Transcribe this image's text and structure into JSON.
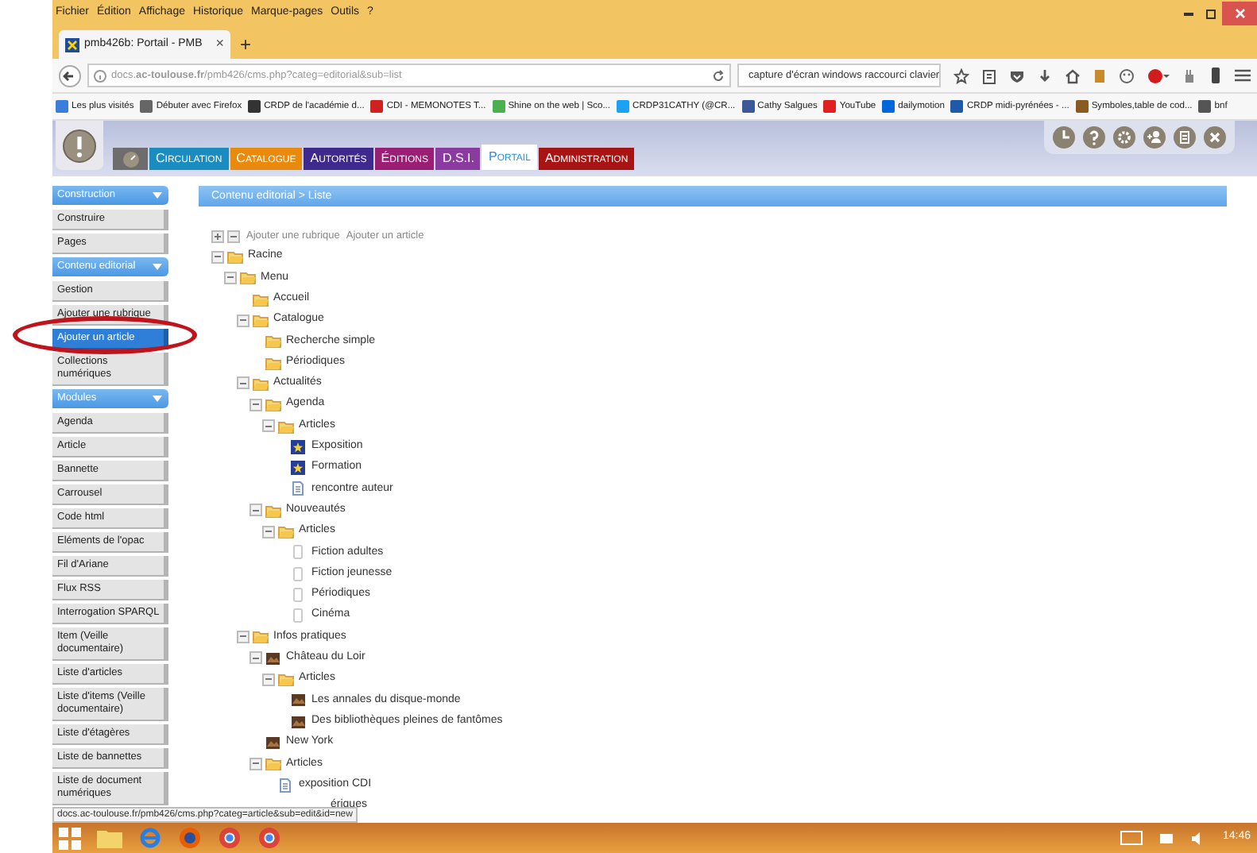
{
  "browser": {
    "menu": [
      "Fichier",
      "Édition",
      "Affichage",
      "Historique",
      "Marque-pages",
      "Outils",
      "?"
    ],
    "tab": {
      "title": "pmb426b: Portail - PMB",
      "close": "×"
    },
    "new_tab": "+",
    "url": "docs.**ac-toulouse.fr**/pmb426/cms.php?categ=editorial&sub=list",
    "search": {
      "value": "capture d'écran windows raccourci clavier"
    },
    "bookmarks": [
      {
        "label": "Les plus visités",
        "color": "#3b7dd8"
      },
      {
        "label": "Débuter avec Firefox",
        "color": "#666666"
      },
      {
        "label": "CRDP de l'académie d...",
        "color": "#333333"
      },
      {
        "label": "CDI - MEMONOTES T...",
        "color": "#d02020"
      },
      {
        "label": "Shine on the web | Sco...",
        "color": "#4caf50"
      },
      {
        "label": "CRDP31CATHY (@CR...",
        "color": "#1da1f2"
      },
      {
        "label": "Cathy Salgues",
        "color": "#3b5998"
      },
      {
        "label": "YouTube",
        "color": "#e02020"
      },
      {
        "label": "dailymotion",
        "color": "#0066dc"
      },
      {
        "label": "CRDP midi-pyrénées - ...",
        "color": "#1e5aa8"
      },
      {
        "label": "Symboles,table de cod...",
        "color": "#8a5a20"
      },
      {
        "label": "bnf",
        "color": "#555555"
      }
    ]
  },
  "pmb": {
    "tabs": [
      {
        "label": "Circulation",
        "color": "#1b8cc0",
        "selected": false
      },
      {
        "label": "Catalogue",
        "color": "#e98a0c",
        "selected": false
      },
      {
        "label": "Autorités",
        "color": "#3d2a8c",
        "selected": false
      },
      {
        "label": "Éditions",
        "color": "#9a1f74",
        "selected": false
      },
      {
        "label": "D.S.I.",
        "color": "#8b3aa0",
        "selected": false
      },
      {
        "label": "Portail",
        "color": "#ffffff",
        "selected": true
      },
      {
        "label": "Administration",
        "color": "#a81414",
        "selected": false
      }
    ]
  },
  "sidebar": [
    {
      "title": "Construction",
      "items": [
        {
          "label": "Construire",
          "selected": false
        },
        {
          "label": "Pages",
          "selected": false
        }
      ]
    },
    {
      "title": "Contenu editorial",
      "items": [
        {
          "label": "Gestion",
          "selected": false
        },
        {
          "label": "Ajouter une rubrique",
          "selected": false
        },
        {
          "label": "Ajouter un article",
          "selected": true
        },
        {
          "label": "Collections numériques",
          "selected": false
        }
      ]
    },
    {
      "title": "Modules",
      "items": [
        {
          "label": "Agenda",
          "selected": false
        },
        {
          "label": "Article",
          "selected": false
        },
        {
          "label": "Bannette",
          "selected": false
        },
        {
          "label": "Carrousel",
          "selected": false
        },
        {
          "label": "Code html",
          "selected": false
        },
        {
          "label": "Eléments de l'opac",
          "selected": false
        },
        {
          "label": "Fil d'Ariane",
          "selected": false
        },
        {
          "label": "Flux RSS",
          "selected": false
        },
        {
          "label": "Interrogation SPARQL",
          "selected": false
        },
        {
          "label": "Item (Veille documentaire)",
          "selected": false
        },
        {
          "label": "Liste d'articles",
          "selected": false
        },
        {
          "label": "Liste d'items (Veille documentaire)",
          "selected": false
        },
        {
          "label": "Liste d'étagères",
          "selected": false
        },
        {
          "label": "Liste de bannettes",
          "selected": false
        },
        {
          "label": "Liste de document numériques",
          "selected": false
        }
      ]
    }
  ],
  "breadcrumb": "Contenu editorial > Liste",
  "tree_actions": [
    "Ajouter une rubrique",
    "Ajouter un article"
  ],
  "tree": [
    {
      "kind": "folder",
      "label": "Racine",
      "children": [
        {
          "kind": "folder",
          "label": "Menu",
          "children": [
            {
              "kind": "folder",
              "label": "Accueil"
            },
            {
              "kind": "folder",
              "label": "Catalogue",
              "children": [
                {
                  "kind": "folder",
                  "label": "Recherche simple"
                },
                {
                  "kind": "folder",
                  "label": "Périodiques"
                }
              ]
            },
            {
              "kind": "folder",
              "label": "Actualités",
              "children": [
                {
                  "kind": "folder",
                  "label": "Agenda",
                  "children": [
                    {
                      "kind": "folder",
                      "label": "Articles",
                      "children": [
                        {
                          "kind": "image",
                          "label": "Exposition"
                        },
                        {
                          "kind": "image",
                          "label": "Formation"
                        },
                        {
                          "kind": "document",
                          "label": "rencontre auteur"
                        }
                      ]
                    }
                  ]
                },
                {
                  "kind": "folder",
                  "label": "Nouveautés",
                  "children": [
                    {
                      "kind": "folder",
                      "label": "Articles",
                      "children": [
                        {
                          "kind": "blank",
                          "label": "Fiction adultes"
                        },
                        {
                          "kind": "blank",
                          "label": "Fiction jeunesse"
                        },
                        {
                          "kind": "blank",
                          "label": "Périodiques"
                        },
                        {
                          "kind": "blank",
                          "label": "Cinéma"
                        }
                      ]
                    }
                  ]
                }
              ]
            },
            {
              "kind": "folder",
              "label": "Infos pratiques",
              "children": [
                {
                  "kind": "photo",
                  "label": "Château du Loir",
                  "children": [
                    {
                      "kind": "folder",
                      "label": "Articles",
                      "children": [
                        {
                          "kind": "photo",
                          "label": "Les annales du disque-monde"
                        },
                        {
                          "kind": "photo",
                          "label": "Des bibliothèques pleines de fantômes"
                        }
                      ]
                    }
                  ]
                },
                {
                  "kind": "photo",
                  "label": "New York"
                },
                {
                  "kind": "folder",
                  "label": "Articles",
                  "children": [
                    {
                      "kind": "document",
                      "label": "exposition CDI"
                    },
                    {
                      "kind": "covered",
                      "label": "ériques"
                    }
                  ]
                }
              ]
            }
          ]
        }
      ]
    }
  ],
  "status_link": "docs.ac-toulouse.fr/pmb426/cms.php?categ=article&sub=edit&id=new",
  "taskbar": {
    "time": "14:46"
  }
}
